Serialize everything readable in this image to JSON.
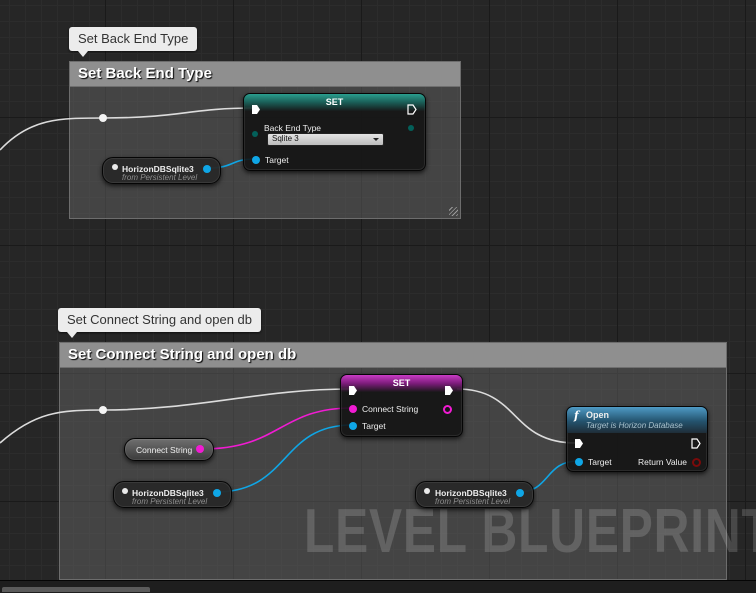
{
  "comment_bubbles": {
    "first": "Set Back End Type",
    "second": "Set Connect String and open db"
  },
  "comment_boxes": {
    "first": {
      "title": "Set Back End Type"
    },
    "second": {
      "title": "Set Connect String and open db"
    }
  },
  "set_backend_node": {
    "title": "SET",
    "field_label": "Back End Type",
    "field_value": "Sqlite 3",
    "target_label": "Target"
  },
  "var_node_1": {
    "name": "HorizonDBSqlite3",
    "source": "from Persistent Level"
  },
  "set_connect_node": {
    "title": "SET",
    "field_label": "Connect String",
    "target_label": "Target"
  },
  "connect_string_var": {
    "name": "Connect String"
  },
  "var_node_2": {
    "name": "HorizonDBSqlite3",
    "source": "from Persistent Level"
  },
  "var_node_3": {
    "name": "HorizonDBSqlite3",
    "source": "from Persistent Level"
  },
  "open_node": {
    "title": "Open",
    "subtitle": "Target is Horizon Database",
    "target_label": "Target",
    "return_label": "Return Value"
  },
  "watermark": "LEVEL BLUEPRINT",
  "colors": {
    "object_pin": "#0fa6e6",
    "string_pin": "#f11bd3",
    "exec_wire": "#dcdcdc",
    "byte_pin": "#03605a",
    "boolean_pin": "#7a0a0a"
  }
}
